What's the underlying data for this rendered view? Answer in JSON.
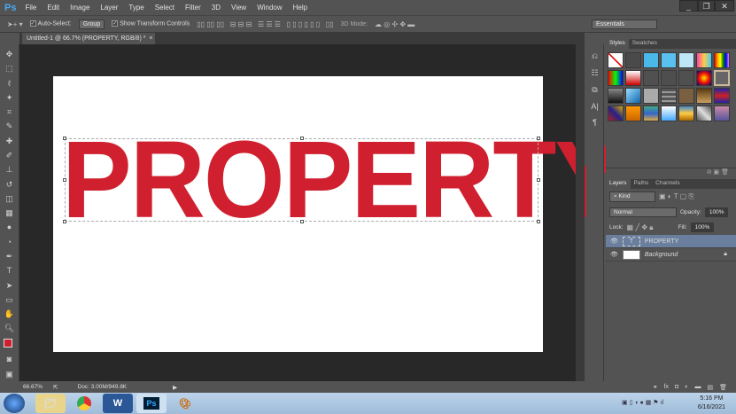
{
  "app": {
    "logo": "Ps"
  },
  "menu": [
    "File",
    "Edit",
    "Image",
    "Layer",
    "Type",
    "Select",
    "Filter",
    "3D",
    "View",
    "Window",
    "Help"
  ],
  "window_controls": {
    "minimize": "_",
    "restore": "❐",
    "close": "✕"
  },
  "options": {
    "auto_select": "Auto-Select:",
    "auto_select_value": "Group",
    "show_transform": "Show Transform Controls",
    "mode_3d": "3D Mode:",
    "workspace": "Essentials"
  },
  "document": {
    "tab_title": "Untitled-1 @ 66.7% (PROPERTY, RGB/8) *",
    "close": "×",
    "text": "PROPERTY",
    "text_color": "#d0202f"
  },
  "status": {
    "zoom": "66.67%",
    "doc": "Doc: 3.00M/949.8K"
  },
  "styles_panel": {
    "tabs": [
      "Styles",
      "Swatches"
    ]
  },
  "layers_panel": {
    "tabs": [
      "Layers",
      "Paths",
      "Channels"
    ],
    "kind": "Kind",
    "blend_mode": "Normal",
    "opacity_label": "Opacity:",
    "opacity": "100%",
    "lock_label": "Lock:",
    "fill_label": "Fill:",
    "fill": "100%",
    "layers": [
      {
        "name": "PROPERTY",
        "type": "text",
        "selected": true
      },
      {
        "name": "Background",
        "type": "image",
        "locked": true
      }
    ]
  },
  "taskbar": {
    "apps": [
      "explorer",
      "chrome",
      "word",
      "photoshop",
      "paint"
    ],
    "time": "5:16 PM",
    "date": "6/16/2021"
  }
}
